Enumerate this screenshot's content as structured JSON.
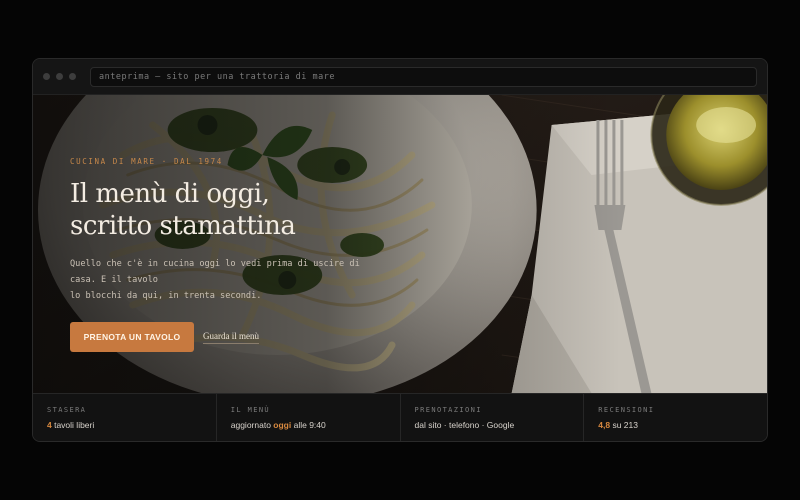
{
  "window": {
    "url_text": "anteprima — sito per una trattoria di mare"
  },
  "hero": {
    "image": "pasta-pesto-plate-fork-napkin-olive-oil-photo",
    "eyebrow": "CUCINA DI MARE · DAL 1974",
    "headline_line1": "Il menù di oggi,",
    "headline_line2": "scritto stamattina",
    "lede_line1": "Quello che c'è in cucina oggi lo vedi prima di uscire di casa. E il tavolo",
    "lede_line2": "lo blocchi da qui, in trenta secondi.",
    "cta_primary": "PRENOTA UN TAVOLO",
    "cta_secondary": "Guarda il menù"
  },
  "stats": [
    {
      "label": "STASERA",
      "value_accent": "4",
      "value_rest": " tavoli liberi"
    },
    {
      "label": "IL MENÙ",
      "value_pre": "aggiornato ",
      "value_accent": "oggi",
      "value_post": " alle 9:40"
    },
    {
      "label": "PRENOTAZIONI",
      "value": "dal sito · telefono · Google"
    },
    {
      "label": "RECENSIONI",
      "value_accent": "4,8",
      "value_rest": " su 213"
    }
  ],
  "colors": {
    "accent": "#c7793f",
    "background": "#050505",
    "panel": "#121212"
  }
}
